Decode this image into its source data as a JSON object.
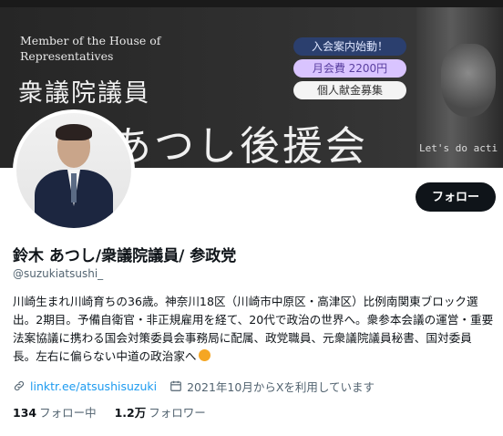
{
  "banner": {
    "subtitle_en": "Member of the House of Representatives",
    "title_jp": "衆議院議員",
    "big_text": "鈴木あつし後援会",
    "tagline": "Let's do acti",
    "pills": [
      "入会案内始動！",
      "月会費 2200円",
      "個人献金募集"
    ]
  },
  "actions": {
    "follow_label": "フォロー"
  },
  "profile": {
    "display_name": "鈴木 あつし/衆議院議員/ 参政党",
    "handle": "@suzukiatsushi_",
    "bio": "川崎生まれ川崎育ちの36歳。神奈川18区（川崎市中原区・高津区）比例南関東ブロック選出。2期目。予備自衛官・非正規雇用を経て、20代で政治の世界へ。衆参本会議の運営・重要法案協議に携わる国会対策委員会事務局に配属、政党職員、元衆議院議員秘書、国対委員長。左右に偏らない中道の政治家へ",
    "link": "linktr.ee/atsushisuzuki",
    "joined": "2021年10月からXを利用しています"
  },
  "stats": {
    "following_count": "134",
    "following_label": "フォロー中",
    "followers_count": "1.2万",
    "followers_label": "フォロワー"
  },
  "icons": {
    "link": "link-icon",
    "calendar": "calendar-icon"
  },
  "colors": {
    "accent": "#1d9bf0",
    "button": "#0f1419",
    "muted": "#536471"
  }
}
